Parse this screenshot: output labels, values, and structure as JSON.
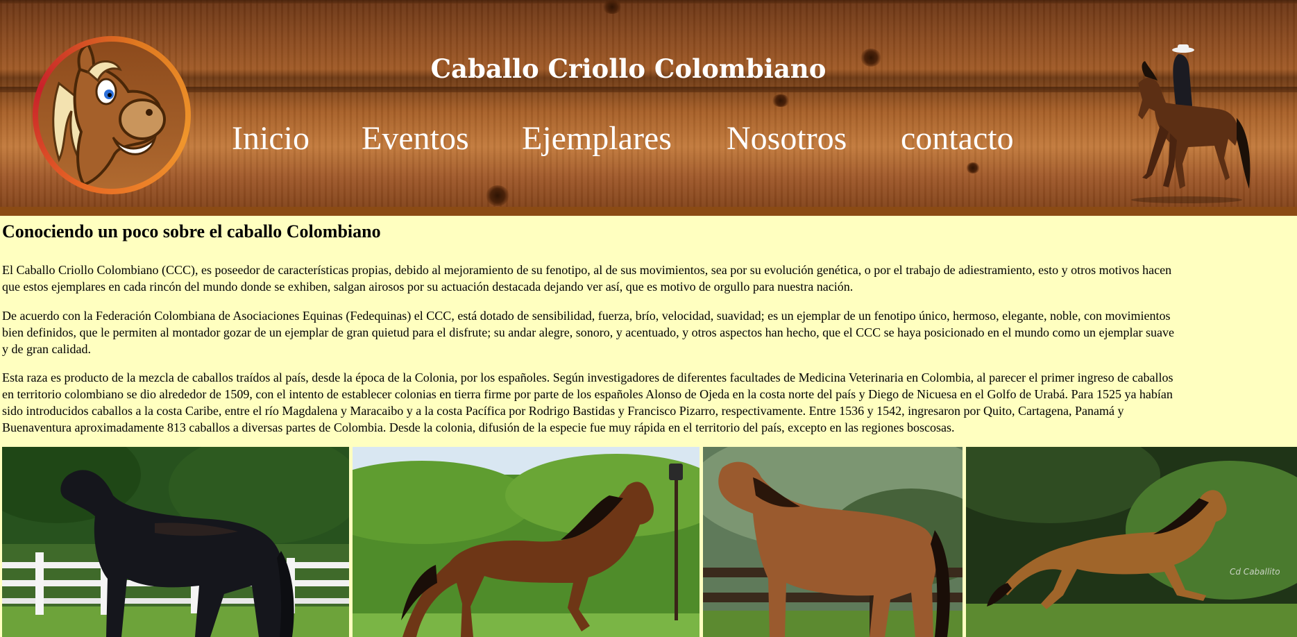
{
  "site": {
    "title": "Caballo Criollo Colombiano"
  },
  "nav": {
    "items": [
      {
        "label": "Inicio"
      },
      {
        "label": "Eventos"
      },
      {
        "label": "Ejemplares"
      },
      {
        "label": "Nosotros"
      },
      {
        "label": "contacto"
      }
    ]
  },
  "main": {
    "heading": "Conociendo un poco sobre el caballo Colombiano",
    "paragraphs": [
      {
        "lines": [
          "El Caballo Criollo Colombiano (CCC), es poseedor de características propias, debido al mejoramiento de su fenotipo, al de sus movimientos, sea por su evolución genética, o por el trabajo de adiestramiento, esto y otros motivos hacen",
          "que estos ejemplares en cada rincón del mundo donde se exhiben, salgan airosos por su actuación destacada dejando ver así, que es motivo de orgullo para nuestra nación."
        ]
      },
      {
        "lines": [
          "De acuerdo con la Federación Colombiana de Asociaciones Equinas (Fedequinas) el CCC, está dotado de sensibilidad, fuerza, brío, velocidad, suavidad; es un ejemplar de un fenotipo único, hermoso, elegante, noble, con movimientos",
          "bien definidos, que le permiten al montador gozar de un ejemplar de gran quietud para el disfrute; su andar alegre, sonoro, y acentuado, y otros aspectos han hecho, que el CCC se haya posicionado en el mundo como un ejemplar suave",
          "y de gran calidad."
        ]
      },
      {
        "lines": [
          "Esta raza es producto de la mezcla de caballos traídos al país, desde la época de la Colonia, por los españoles. Según investigadores de diferentes facultades de Medicina Veterinaria en Colombia, al parecer el primer ingreso de caballos",
          "en territorio colombiano se dio alrededor de 1509, con el intento de establecer colonias en tierra firme por parte de los españoles Alonso de Ojeda en la costa norte del país y Diego de Nicuesa en el Golfo de Urabá. Para 1525 ya habían",
          "sido introducidos caballos a la costa Caribe, entre el río Magdalena y Maracaibo y a la costa Pacífica por Rodrigo Bastidas y Francisco Pizarro, respectivamente. Entre 1536 y 1542, ingresaron por Quito, Cartagena, Panamá y",
          "Buenaventura aproximadamente 813 caballos a diversas partes de Colombia. Desde la colonia, difusión de la especie fue muy rápida en el territorio del país, excepto en las regiones boscosas."
        ]
      }
    ]
  },
  "gallery": {
    "photo_signature": "Cd Caballito"
  },
  "colors": {
    "page_background": "#ffffc0",
    "header_wood": "#a05a26",
    "header_bar": "#8b4b14",
    "nav_text": "#ffffff"
  },
  "icons": {
    "logo": "cartoon-horse-logo",
    "rider": "horse-rider-image"
  }
}
